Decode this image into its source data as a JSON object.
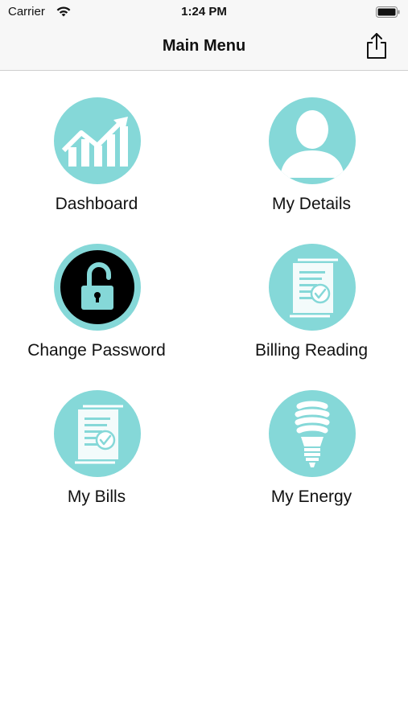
{
  "status_bar": {
    "carrier": "Carrier",
    "time": "1:24 PM",
    "wifi_icon": "wifi-icon",
    "battery_icon": "battery-icon"
  },
  "nav": {
    "title": "Main Menu",
    "share_icon": "share-icon"
  },
  "theme": {
    "accent": "#85d8d8",
    "icon_fg": "#ffffff",
    "lock_bg": "#000000",
    "nav_bg": "#f7f7f7"
  },
  "menu": {
    "items": [
      {
        "label": "Dashboard",
        "icon": "chart-growth-icon"
      },
      {
        "label": "My Details",
        "icon": "user-icon"
      },
      {
        "label": "Change Password",
        "icon": "unlock-icon"
      },
      {
        "label": "Billing Reading",
        "icon": "document-check-icon"
      },
      {
        "label": "My Bills",
        "icon": "document-check-icon"
      },
      {
        "label": "My Energy",
        "icon": "lightbulb-icon"
      }
    ]
  }
}
